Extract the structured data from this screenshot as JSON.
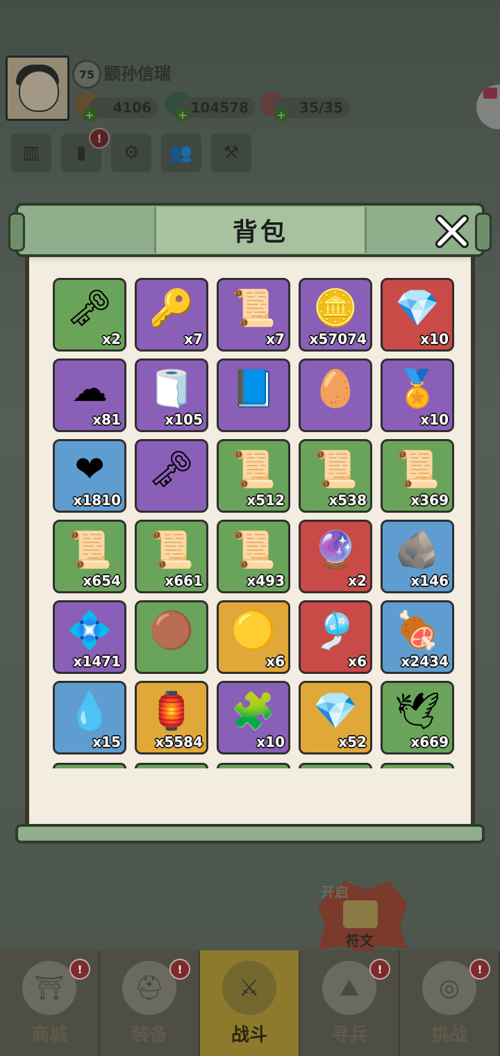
{
  "player": {
    "level": "75",
    "name": "颛孙信瑞"
  },
  "resources": [
    {
      "value": "4106"
    },
    {
      "value": "104578"
    },
    {
      "value": "35/35"
    }
  ],
  "modal": {
    "title": "背包",
    "items": [
      {
        "icon": "silver-key",
        "count": "x2",
        "quality": "green",
        "glyph": "🗝"
      },
      {
        "icon": "gold-cloud-key",
        "count": "x7",
        "quality": "purple",
        "glyph": "🔑"
      },
      {
        "icon": "scroll-medal",
        "count": "x7",
        "quality": "purple",
        "glyph": "📜"
      },
      {
        "icon": "gold-coin",
        "count": "x57074",
        "quality": "purple",
        "glyph": "🪙"
      },
      {
        "icon": "crystal-ore",
        "count": "x10",
        "quality": "red",
        "glyph": "💎"
      },
      {
        "icon": "rainbow-cloud",
        "count": "x81",
        "quality": "purple",
        "glyph": "☁"
      },
      {
        "icon": "rolled-scroll",
        "count": "x105",
        "quality": "purple",
        "glyph": "🧻"
      },
      {
        "icon": "blue-talisman",
        "count": "",
        "quality": "purple",
        "glyph": "📘"
      },
      {
        "icon": "dragon-egg",
        "count": "",
        "quality": "purple",
        "glyph": "🥚"
      },
      {
        "icon": "order-token",
        "count": "x10",
        "quality": "purple",
        "glyph": "🏅"
      },
      {
        "icon": "heart",
        "count": "x1810",
        "quality": "blue",
        "glyph": "❤"
      },
      {
        "icon": "ruby-key",
        "count": "",
        "quality": "purple",
        "glyph": "🗝"
      },
      {
        "icon": "green-scroll",
        "count": "x512",
        "quality": "green",
        "glyph": "📜"
      },
      {
        "icon": "green-scroll",
        "count": "x538",
        "quality": "green",
        "glyph": "📜"
      },
      {
        "icon": "green-scroll",
        "count": "x369",
        "quality": "green",
        "glyph": "📜"
      },
      {
        "icon": "green-scroll",
        "count": "x654",
        "quality": "green",
        "glyph": "📜"
      },
      {
        "icon": "green-scroll",
        "count": "x661",
        "quality": "green",
        "glyph": "📜"
      },
      {
        "icon": "green-scroll",
        "count": "x493",
        "quality": "green",
        "glyph": "📜"
      },
      {
        "icon": "crystal-ball",
        "count": "x2",
        "quality": "red",
        "glyph": "🔮"
      },
      {
        "icon": "dark-crystal",
        "count": "x146",
        "quality": "blue",
        "glyph": "🪨"
      },
      {
        "icon": "gem-cluster",
        "count": "x1471",
        "quality": "purple",
        "glyph": "💠"
      },
      {
        "icon": "red-orb",
        "count": "",
        "quality": "green",
        "glyph": "🟤"
      },
      {
        "icon": "jade-plate",
        "count": "x6",
        "quality": "gold",
        "glyph": "🟡"
      },
      {
        "icon": "blue-charm",
        "count": "x6",
        "quality": "red",
        "glyph": "🎐"
      },
      {
        "icon": "meat-basket",
        "count": "x2434",
        "quality": "blue",
        "glyph": "🍖"
      },
      {
        "icon": "water-drop",
        "count": "x15",
        "quality": "blue",
        "glyph": "💧"
      },
      {
        "icon": "points-badge",
        "count": "x5584",
        "quality": "gold",
        "glyph": "🏮"
      },
      {
        "icon": "gold-puzzle",
        "count": "x10",
        "quality": "purple",
        "glyph": "🧩"
      },
      {
        "icon": "fire-crystal",
        "count": "x52",
        "quality": "gold",
        "glyph": "💎"
      },
      {
        "icon": "wing-scroll",
        "count": "x669",
        "quality": "green",
        "glyph": "🕊"
      }
    ],
    "next_row_qualities": [
      "green",
      "green",
      "green",
      "green",
      "green"
    ]
  },
  "rune_badge": {
    "open": "开启",
    "label": "符文"
  },
  "nav": [
    {
      "label": "商城",
      "icon": "shop-icon",
      "alert": "!"
    },
    {
      "label": "装备",
      "icon": "equipment-icon",
      "alert": "!"
    },
    {
      "label": "战斗",
      "icon": "battle-icon",
      "active": true
    },
    {
      "label": "寻兵",
      "icon": "summon-icon",
      "alert": "!"
    },
    {
      "label": "挑战",
      "icon": "challenge-icon",
      "alert": "!"
    }
  ],
  "alerts": {
    "quick": "!"
  },
  "colors": {
    "green": "#6aa45a",
    "purple": "#8a5fb8",
    "red": "#c94a46",
    "blue": "#5f9dd0",
    "gold": "#e0a838",
    "frame": "#8fae8b"
  }
}
